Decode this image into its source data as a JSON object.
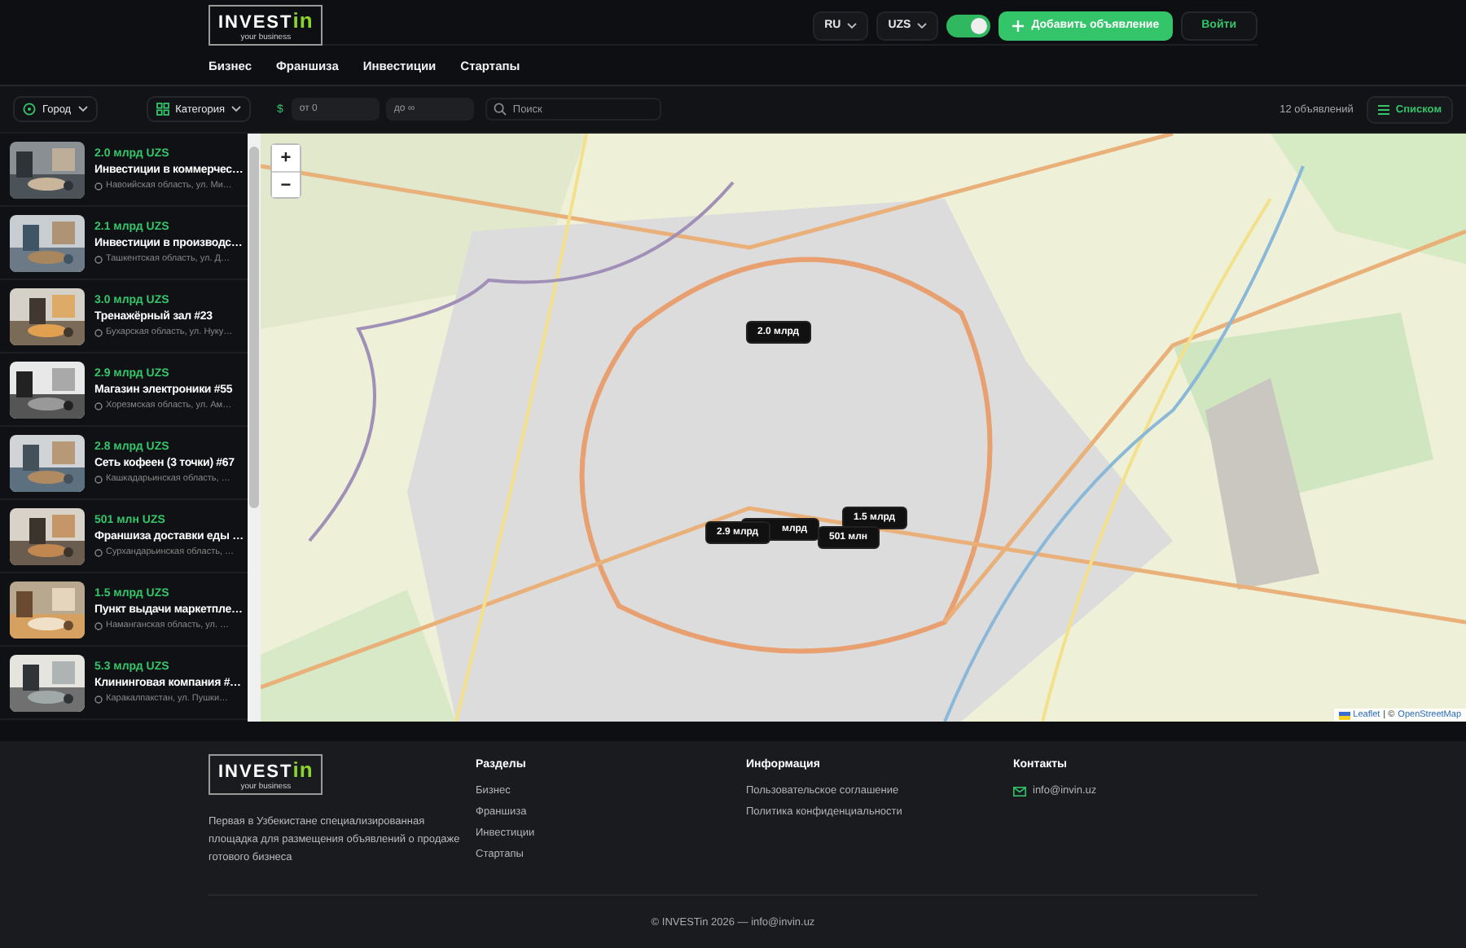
{
  "header": {
    "logo": {
      "brand": "INVEST",
      "accent": "in",
      "tagline": "your business"
    },
    "language": "RU",
    "currency": "UZS",
    "theme_toggle": {
      "on": true
    },
    "add_button": "Добавить объявление",
    "login_button": "Войти",
    "nav": [
      {
        "label": "Бизнес"
      },
      {
        "label": "Франшиза"
      },
      {
        "label": "Инвестиции"
      },
      {
        "label": "Стартапы"
      }
    ]
  },
  "filters": {
    "city": "Город",
    "category": "Категория",
    "currency_sign": "$",
    "price_from": {
      "placeholder": "от 0"
    },
    "price_to": {
      "placeholder": "до ∞"
    },
    "search": {
      "placeholder": "Поиск"
    },
    "count": "12 объявлений",
    "view_button": "Списком"
  },
  "listings": [
    {
      "price": "2.0 млрд UZS",
      "title": "Инвестиции в коммерчес…",
      "location": "Навоийская область, ул. Ми…"
    },
    {
      "price": "2.1 млрд UZS",
      "title": "Инвестиции в производс…",
      "location": "Ташкентская область, ул. Д…"
    },
    {
      "price": "3.0 млрд UZS",
      "title": "Тренажёрный зал #23",
      "location": "Бухарская область, ул. Нуку…"
    },
    {
      "price": "2.9 млрд UZS",
      "title": "Магазин электроники #55",
      "location": "Хорезмская область, ул. Ам…"
    },
    {
      "price": "2.8 млрд UZS",
      "title": "Сеть кофеен (3 точки) #67",
      "location": "Кашкадарьинская область, …"
    },
    {
      "price": "501 млн UZS",
      "title": "Франшиза доставки еды …",
      "location": "Сурхандарьинская область, …"
    },
    {
      "price": "1.5 млрд UZS",
      "title": "Пункт выдачи маркетпле…",
      "location": "Наманганская область, ул. …"
    },
    {
      "price": "5.3 млрд UZS",
      "title": "Клининговая компания #…",
      "location": "Каракалпакстан, ул. Пушки…"
    }
  ],
  "map": {
    "zoom_in": "+",
    "zoom_out": "−",
    "markers": [
      {
        "label": "2.0 млрд"
      },
      {
        "label": "млрд"
      },
      {
        "label": "2.9 млрд"
      },
      {
        "label": "1.5 млрд"
      },
      {
        "label": "501 млн"
      }
    ],
    "attribution": {
      "leaflet": "Leaflet",
      "separator": "| ©",
      "osm": "OpenStreetMap"
    }
  },
  "footer": {
    "logo": {
      "brand": "INVEST",
      "accent": "in",
      "tagline": "your business"
    },
    "description": "Первая в Узбекистане специализированная площадка для размещения объявлений о продаже готового бизнеса",
    "columns": [
      {
        "title": "Разделы",
        "links": [
          "Бизнес",
          "Франшиза",
          "Инвестиции",
          "Стартапы"
        ]
      },
      {
        "title": "Информация",
        "links": [
          "Пользовательское соглашение",
          "Политика конфиденциальности"
        ]
      },
      {
        "title": "Контакты",
        "kind": "contacts",
        "links": [
          "info@invin.uz"
        ]
      }
    ],
    "copyright": "© INVESTin 2026 — info@invin.uz"
  }
}
